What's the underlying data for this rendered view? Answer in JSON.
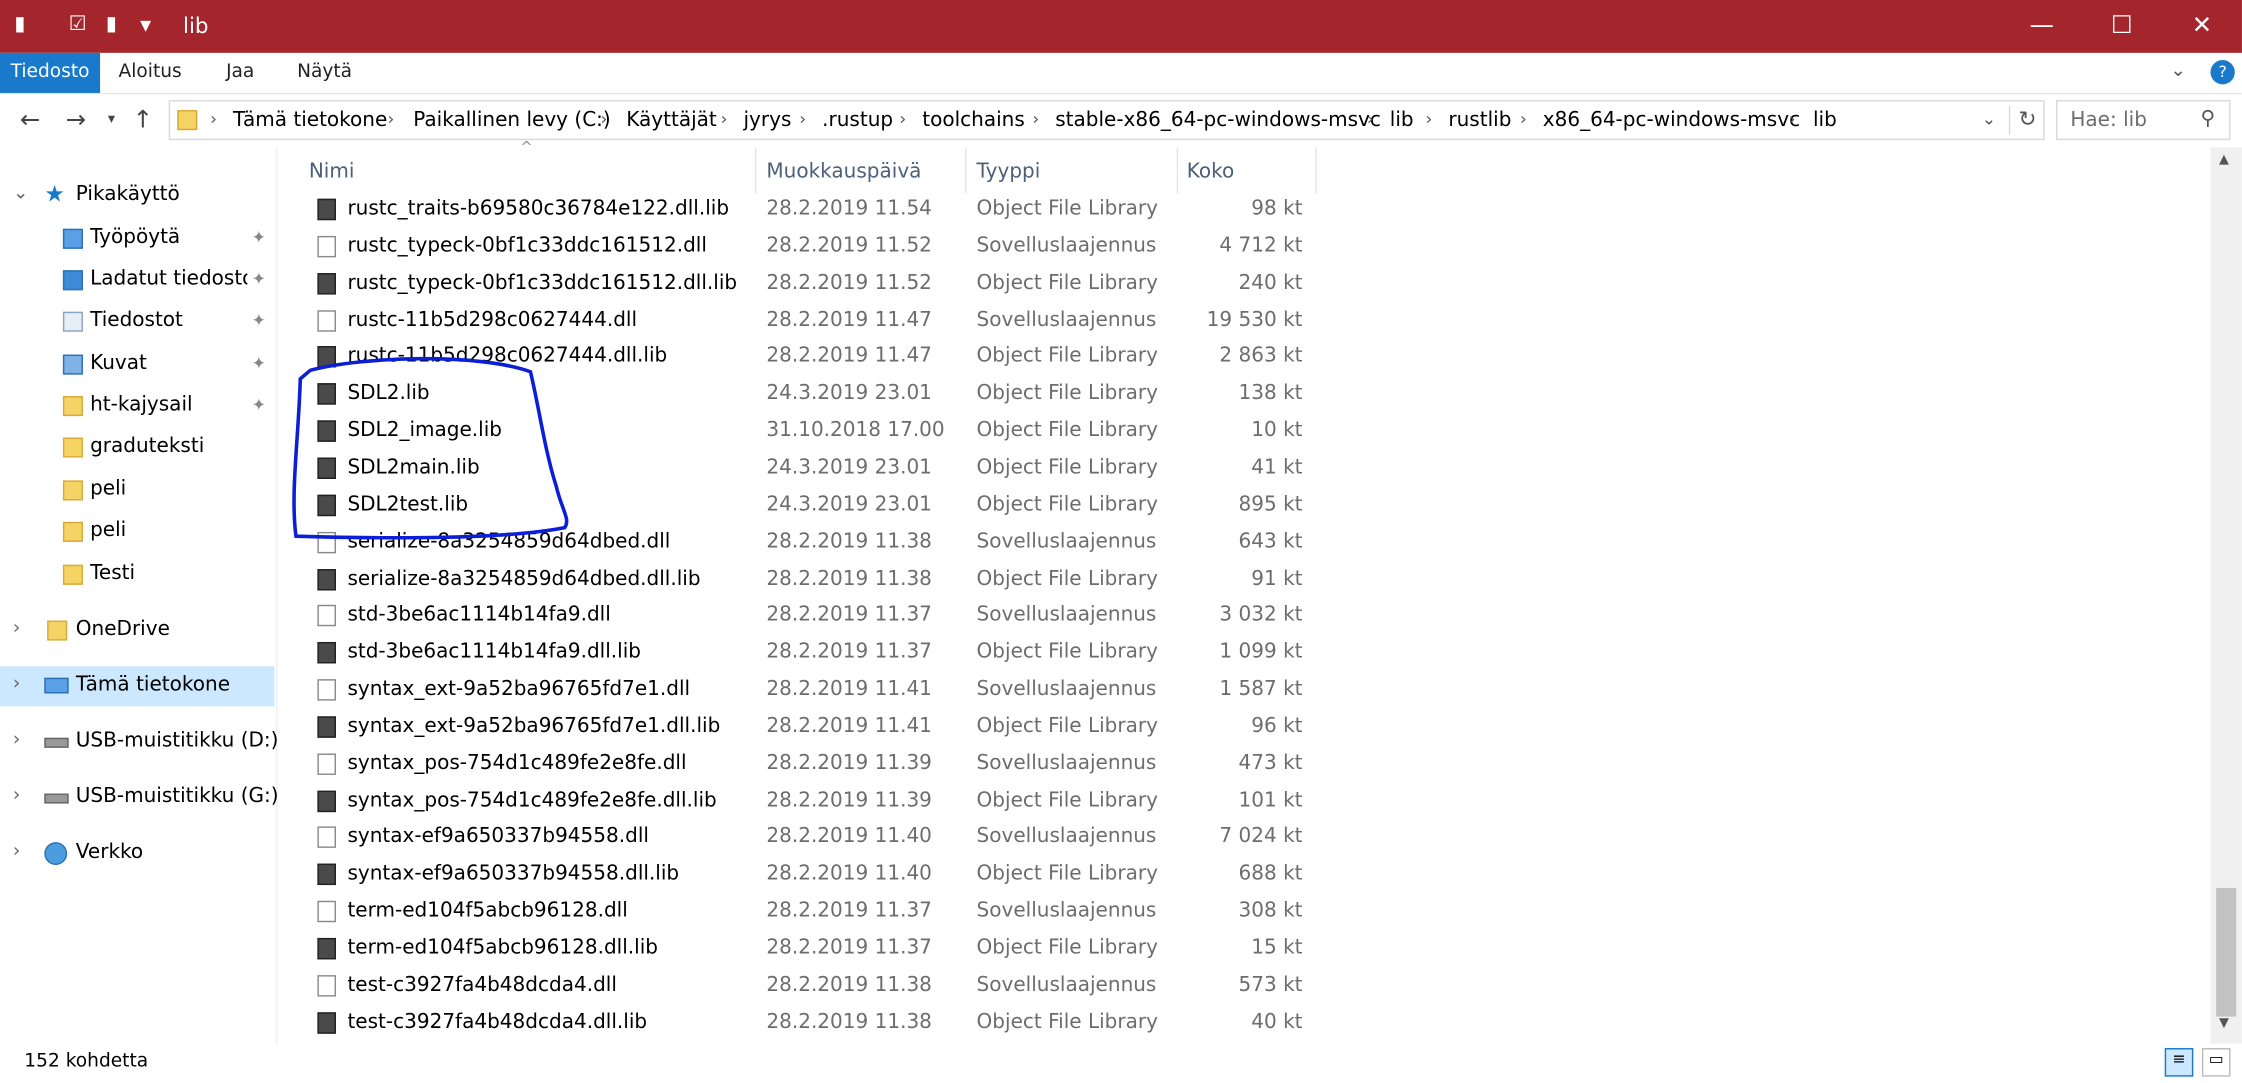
{
  "title": "lib",
  "window_buttons": {
    "minimize": "—",
    "maximize": "☐",
    "close": "✕"
  },
  "ribbon": {
    "tabs": [
      "Tiedosto",
      "Aloitus",
      "Jaa",
      "Näytä"
    ],
    "help": "?"
  },
  "address": {
    "crumbs": [
      "Tämä tietokone",
      "Paikallinen levy (C:)",
      "Käyttäjät",
      "jyrys",
      ".rustup",
      "toolchains",
      "stable-x86_64-pc-windows-msvc",
      "lib",
      "rustlib",
      "x86_64-pc-windows-msvc",
      "lib"
    ],
    "search_placeholder": "Hae: lib"
  },
  "nav": {
    "quick_access": "Pikakäyttö",
    "pinned": [
      "Työpöytä",
      "Ladatut tiedostot",
      "Tiedostot",
      "Kuvat",
      "ht-kajysail"
    ],
    "folders": [
      "graduteksti",
      "peli",
      "peli",
      "Testi"
    ],
    "onedrive": "OneDrive",
    "this_pc": "Tämä tietokone",
    "usb_d": "USB-muistitikku (D:)",
    "usb_g": "USB-muistitikku (G:)",
    "network": "Verkko"
  },
  "columns": {
    "name": "Nimi",
    "modified": "Muokkauspäivä",
    "type": "Tyyppi",
    "size": "Koko"
  },
  "files": [
    {
      "name": "rustc_traits-b69580c36784e122.dll.lib",
      "date": "28.2.2019 11.54",
      "type": "Object File Library",
      "size": "98 kt",
      "kind": "lib"
    },
    {
      "name": "rustc_typeck-0bf1c33ddc161512.dll",
      "date": "28.2.2019 11.52",
      "type": "Sovelluslaajennus",
      "size": "4 712 kt",
      "kind": "dll"
    },
    {
      "name": "rustc_typeck-0bf1c33ddc161512.dll.lib",
      "date": "28.2.2019 11.52",
      "type": "Object File Library",
      "size": "240 kt",
      "kind": "lib"
    },
    {
      "name": "rustc-11b5d298c0627444.dll",
      "date": "28.2.2019 11.47",
      "type": "Sovelluslaajennus",
      "size": "19 530 kt",
      "kind": "dll"
    },
    {
      "name": "rustc-11b5d298c0627444.dll.lib",
      "date": "28.2.2019 11.47",
      "type": "Object File Library",
      "size": "2 863 kt",
      "kind": "lib"
    },
    {
      "name": "SDL2.lib",
      "date": "24.3.2019 23.01",
      "type": "Object File Library",
      "size": "138 kt",
      "kind": "lib"
    },
    {
      "name": "SDL2_image.lib",
      "date": "31.10.2018 17.00",
      "type": "Object File Library",
      "size": "10 kt",
      "kind": "lib"
    },
    {
      "name": "SDL2main.lib",
      "date": "24.3.2019 23.01",
      "type": "Object File Library",
      "size": "41 kt",
      "kind": "lib"
    },
    {
      "name": "SDL2test.lib",
      "date": "24.3.2019 23.01",
      "type": "Object File Library",
      "size": "895 kt",
      "kind": "lib"
    },
    {
      "name": "serialize-8a3254859d64dbed.dll",
      "date": "28.2.2019 11.38",
      "type": "Sovelluslaajennus",
      "size": "643 kt",
      "kind": "dll"
    },
    {
      "name": "serialize-8a3254859d64dbed.dll.lib",
      "date": "28.2.2019 11.38",
      "type": "Object File Library",
      "size": "91 kt",
      "kind": "lib"
    },
    {
      "name": "std-3be6ac1114b14fa9.dll",
      "date": "28.2.2019 11.37",
      "type": "Sovelluslaajennus",
      "size": "3 032 kt",
      "kind": "dll"
    },
    {
      "name": "std-3be6ac1114b14fa9.dll.lib",
      "date": "28.2.2019 11.37",
      "type": "Object File Library",
      "size": "1 099 kt",
      "kind": "lib"
    },
    {
      "name": "syntax_ext-9a52ba96765fd7e1.dll",
      "date": "28.2.2019 11.41",
      "type": "Sovelluslaajennus",
      "size": "1 587 kt",
      "kind": "dll"
    },
    {
      "name": "syntax_ext-9a52ba96765fd7e1.dll.lib",
      "date": "28.2.2019 11.41",
      "type": "Object File Library",
      "size": "96 kt",
      "kind": "lib"
    },
    {
      "name": "syntax_pos-754d1c489fe2e8fe.dll",
      "date": "28.2.2019 11.39",
      "type": "Sovelluslaajennus",
      "size": "473 kt",
      "kind": "dll"
    },
    {
      "name": "syntax_pos-754d1c489fe2e8fe.dll.lib",
      "date": "28.2.2019 11.39",
      "type": "Object File Library",
      "size": "101 kt",
      "kind": "lib"
    },
    {
      "name": "syntax-ef9a650337b94558.dll",
      "date": "28.2.2019 11.40",
      "type": "Sovelluslaajennus",
      "size": "7 024 kt",
      "kind": "dll"
    },
    {
      "name": "syntax-ef9a650337b94558.dll.lib",
      "date": "28.2.2019 11.40",
      "type": "Object File Library",
      "size": "688 kt",
      "kind": "lib"
    },
    {
      "name": "term-ed104f5abcb96128.dll",
      "date": "28.2.2019 11.37",
      "type": "Sovelluslaajennus",
      "size": "308 kt",
      "kind": "dll"
    },
    {
      "name": "term-ed104f5abcb96128.dll.lib",
      "date": "28.2.2019 11.37",
      "type": "Object File Library",
      "size": "15 kt",
      "kind": "lib"
    },
    {
      "name": "test-c3927fa4b48dcda4.dll",
      "date": "28.2.2019 11.38",
      "type": "Sovelluslaajennus",
      "size": "573 kt",
      "kind": "dll"
    },
    {
      "name": "test-c3927fa4b48dcda4.dll.lib",
      "date": "28.2.2019 11.38",
      "type": "Object File Library",
      "size": "40 kt",
      "kind": "lib"
    }
  ],
  "status": "152 kohdetta",
  "colors": {
    "titlebar": "#a4262c",
    "accent": "#1979ca",
    "selection": "#cce8ff",
    "annotation": "#0b1fd6"
  }
}
